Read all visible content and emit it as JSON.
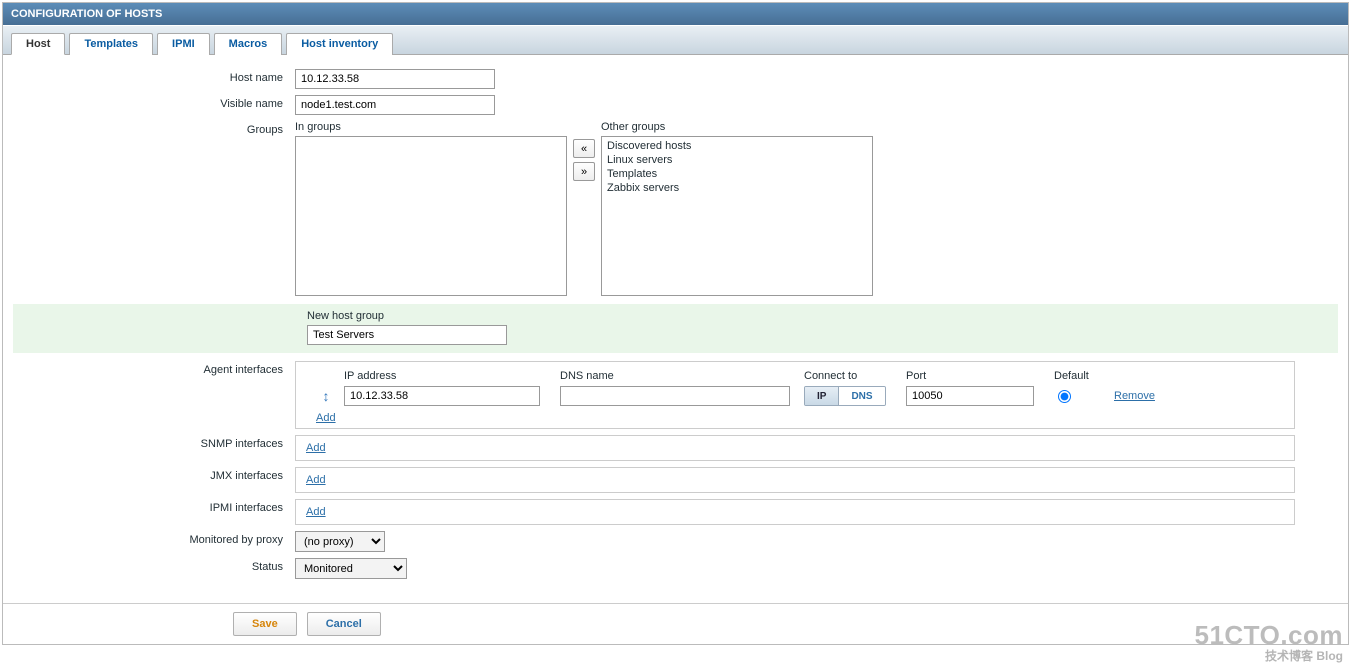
{
  "title": "CONFIGURATION OF HOSTS",
  "tabs": [
    {
      "label": "Host",
      "active": true
    },
    {
      "label": "Templates",
      "active": false
    },
    {
      "label": "IPMI",
      "active": false
    },
    {
      "label": "Macros",
      "active": false
    },
    {
      "label": "Host inventory",
      "active": false
    }
  ],
  "labels": {
    "host_name": "Host name",
    "visible_name": "Visible name",
    "groups": "Groups",
    "in_groups": "In groups",
    "other_groups": "Other groups",
    "new_host_group": "New host group",
    "agent_interfaces": "Agent interfaces",
    "snmp_interfaces": "SNMP interfaces",
    "jmx_interfaces": "JMX interfaces",
    "ipmi_interfaces": "IPMI interfaces",
    "monitored_by_proxy": "Monitored by proxy",
    "status": "Status",
    "ip_address": "IP address",
    "dns_name": "DNS name",
    "connect_to": "Connect to",
    "port": "Port",
    "default": "Default",
    "add": "Add",
    "remove": "Remove",
    "ip_btn": "IP",
    "dns_btn": "DNS",
    "move_left": "«",
    "move_right": "»"
  },
  "values": {
    "host_name": "10.12.33.58",
    "visible_name": "node1.test.com",
    "new_host_group": "Test Servers",
    "agent_ip": "10.12.33.58",
    "agent_dns": "",
    "agent_port": "10050",
    "proxy_selected": "(no proxy)",
    "status_selected": "Monitored"
  },
  "other_groups": [
    "Discovered hosts",
    "Linux servers",
    "Templates",
    "Zabbix servers"
  ],
  "buttons": {
    "save": "Save",
    "cancel": "Cancel"
  },
  "watermark": {
    "big": "51CTO.com",
    "small": "技术博客   Blog"
  }
}
